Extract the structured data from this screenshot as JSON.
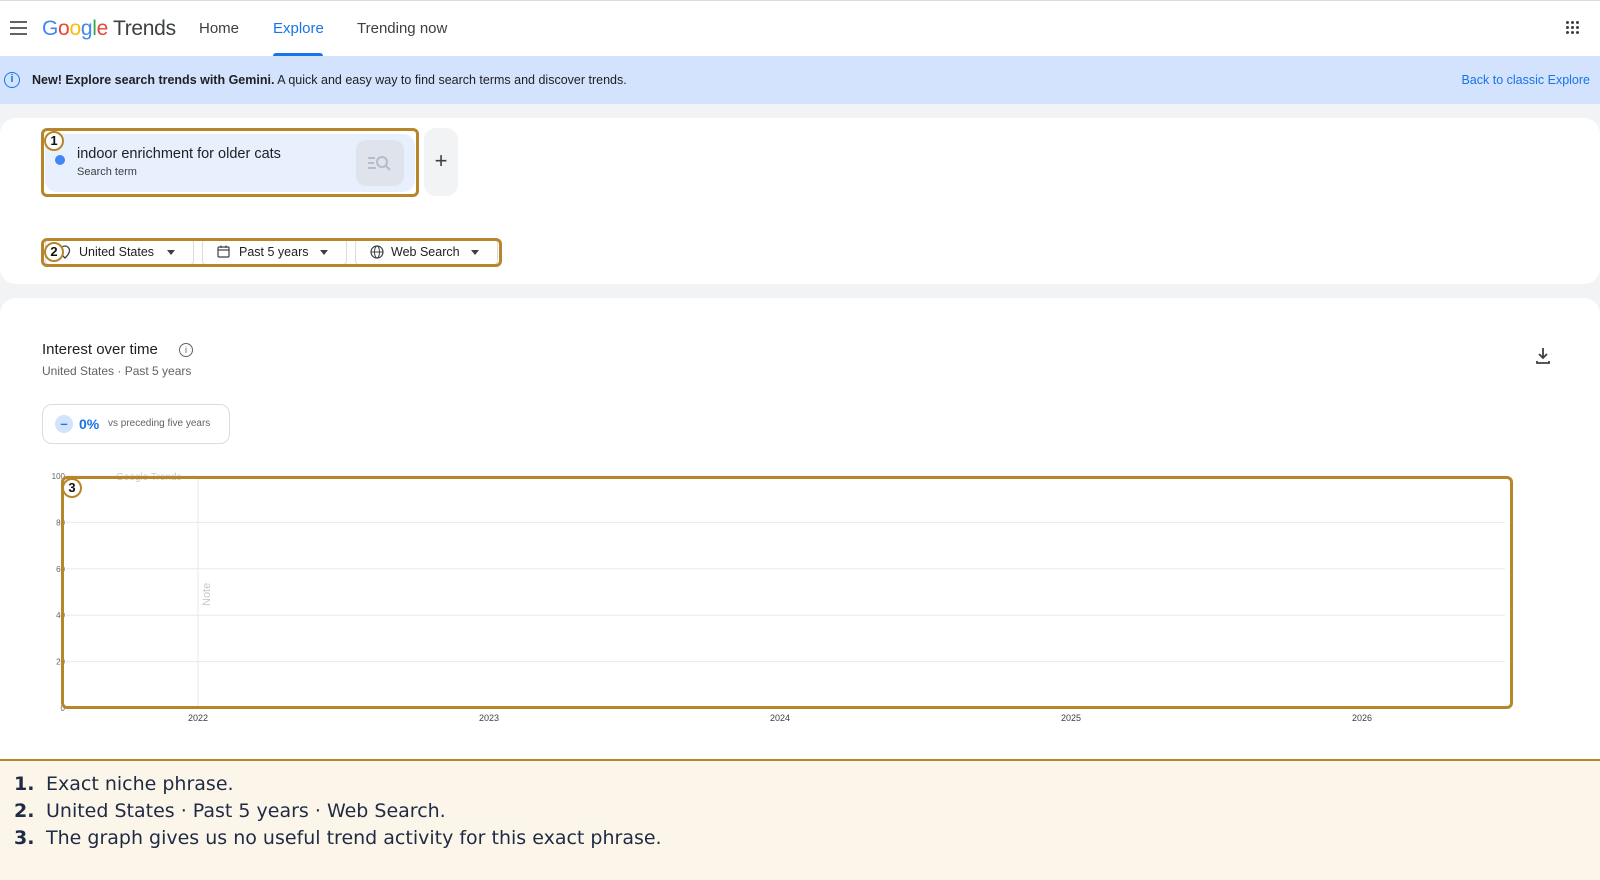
{
  "header": {
    "logo_google": [
      "G",
      "o",
      "o",
      "g",
      "l",
      "e"
    ],
    "logo_trends": "Trends",
    "nav": [
      "Home",
      "Explore",
      "Trending now"
    ],
    "active_tab": "Explore"
  },
  "banner": {
    "bold": "New! Explore search trends with Gemini.",
    "text": "A quick and easy way to find search terms and discover trends.",
    "link": "Back to classic Explore"
  },
  "search": {
    "term": "indoor enrichment for older cats",
    "term_type": "Search term",
    "add_symbol": "+"
  },
  "filters": {
    "location": "United States",
    "time": "Past 5 years",
    "property": "Web Search"
  },
  "chart_panel": {
    "title": "Interest over time",
    "subtitle": "United States · Past 5 years",
    "stat_value": "0%",
    "stat_label": "vs preceding five years",
    "watermark": "Google Trends"
  },
  "chart_data": {
    "type": "line",
    "x_ticks": [
      "2022",
      "2023",
      "2024",
      "2025",
      "2026"
    ],
    "y_ticks": [
      0,
      20,
      40,
      60,
      80,
      100
    ],
    "ylim": [
      0,
      100
    ],
    "series": [],
    "annotation": "Note",
    "grid": true
  },
  "annotations": {
    "labels": [
      "1",
      "2",
      "3"
    ],
    "notes": [
      {
        "num": "1.",
        "text": "Exact niche phrase."
      },
      {
        "num": "2.",
        "text": "United States · Past 5 years · Web Search."
      },
      {
        "num": "3.",
        "text": "The graph gives us no useful trend activity for this exact phrase."
      }
    ]
  },
  "colors": {
    "accent": "#1a73e8",
    "banner": "#d3e3fd",
    "annotation": "#b8862a",
    "term_dot": "#4285f4"
  }
}
